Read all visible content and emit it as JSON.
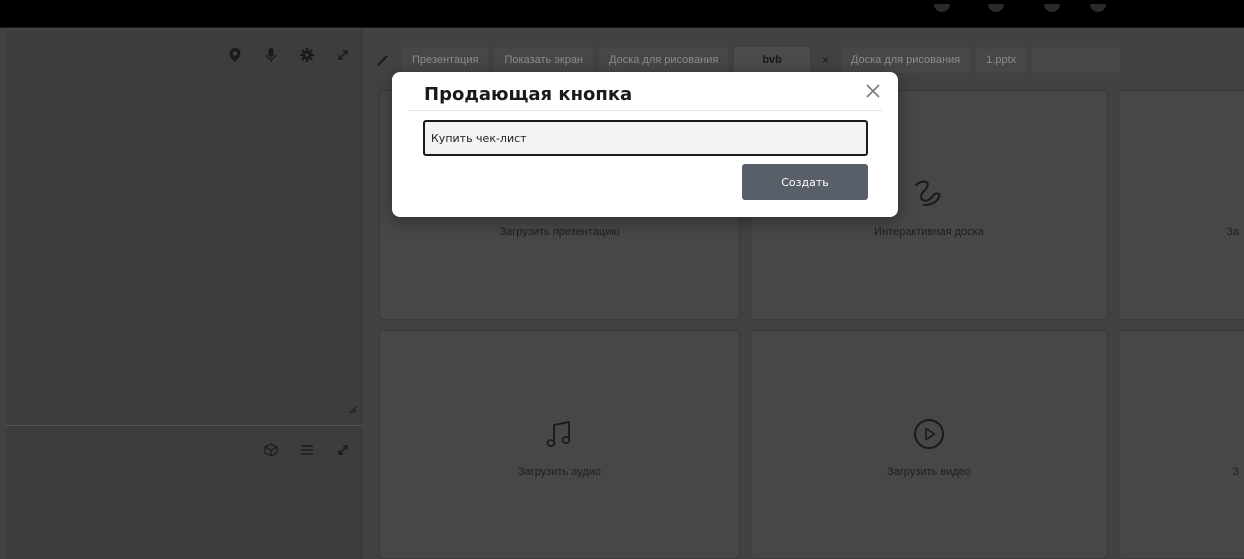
{
  "tabs": [
    {
      "label": "Презентация",
      "active": false
    },
    {
      "label": "Показать экран",
      "active": false
    },
    {
      "label": "Доска для рисования",
      "active": false
    },
    {
      "label": "bvb",
      "active": true
    },
    {
      "label": "Доска для рисования",
      "active": false
    },
    {
      "label": "1.pptx",
      "active": false
    }
  ],
  "tab_close_glyph": "×",
  "cards": {
    "upload_presentation": "Загрузить презентацию",
    "interactive_board": "Интерактивная доска",
    "upload_audio": "Загрузить аудио",
    "upload_video": "Загрузить видео",
    "cut_right_top": "За",
    "cut_right_bottom": "З"
  },
  "modal": {
    "title": "Продающая кнопка",
    "input_value": "Купить чек-лист",
    "submit_label": "Создать"
  },
  "icons": {
    "left_toolbar": [
      "location-pin-icon",
      "microphone-icon",
      "gear-icon",
      "expand-icon"
    ],
    "left_toolbar2": [
      "cube-icon",
      "menu-icon",
      "expand-icon"
    ],
    "tabbar": "brush-icon",
    "modal_close": "close-icon"
  },
  "colors": {
    "background": "#424242",
    "card": "#474747",
    "modal": "#ffffff",
    "submit_button": "#585f69",
    "input_background": "#f3f3f3"
  }
}
